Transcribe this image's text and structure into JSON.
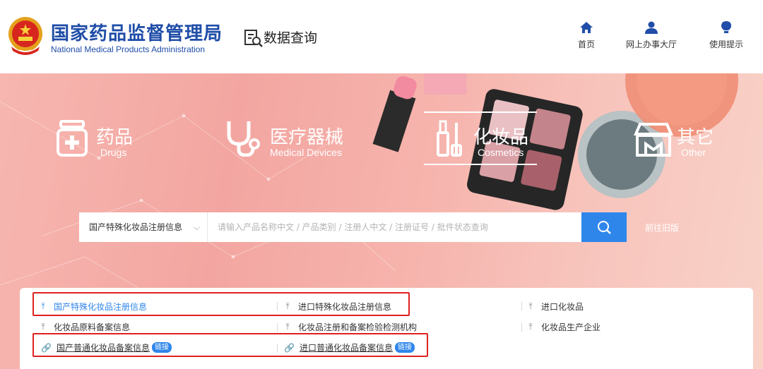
{
  "header": {
    "org_cn": "国家药品监督管理局",
    "org_en": "National Medical Products Administration",
    "data_query": "数据查询",
    "nav": [
      {
        "label": "首页",
        "icon": "home-icon"
      },
      {
        "label": "网上办事大厅",
        "icon": "user-icon"
      },
      {
        "label": "使用提示",
        "icon": "lightbulb-icon"
      }
    ]
  },
  "categories": [
    {
      "cn": "药品",
      "en": "Drugs",
      "icon": "medicine-bottle-icon",
      "active": false
    },
    {
      "cn": "医疗器械",
      "en": "Medical Devices",
      "icon": "stethoscope-icon",
      "active": false
    },
    {
      "cn": "化妆品",
      "en": "Cosmetics",
      "icon": "cosmetics-icon",
      "active": true
    },
    {
      "cn": "其它",
      "en": "Other",
      "icon": "store-icon",
      "active": false
    }
  ],
  "search": {
    "selected": "国产特殊化妆品注册信息",
    "placeholder": "请输入产品名称中文 / 产品类别 / 注册人中文 / 注册证号 / 批件状态查询",
    "old_version": "前往旧版"
  },
  "items": [
    {
      "label": "国产特殊化妆品注册信息",
      "icon": "upload-icon",
      "active": true
    },
    {
      "label": "进口特殊化妆品注册信息",
      "icon": "upload-icon"
    },
    {
      "label": "进口化妆品",
      "icon": "upload-icon"
    },
    {
      "label": "化妆品原料备案信息",
      "icon": "upload-icon"
    },
    {
      "label": "化妆品注册和备案检验检测机构",
      "icon": "upload-icon"
    },
    {
      "label": "化妆品生产企业",
      "icon": "upload-icon"
    },
    {
      "label": "国产普通化妆品备案信息",
      "icon": "link-icon",
      "badge": "链接"
    },
    {
      "label": "进口普通化妆品备案信息",
      "icon": "link-icon",
      "badge": "链接"
    }
  ],
  "colors": {
    "brand_blue": "#1f4da8",
    "accent_blue": "#2f86ea",
    "highlight_red": "#e02020"
  }
}
